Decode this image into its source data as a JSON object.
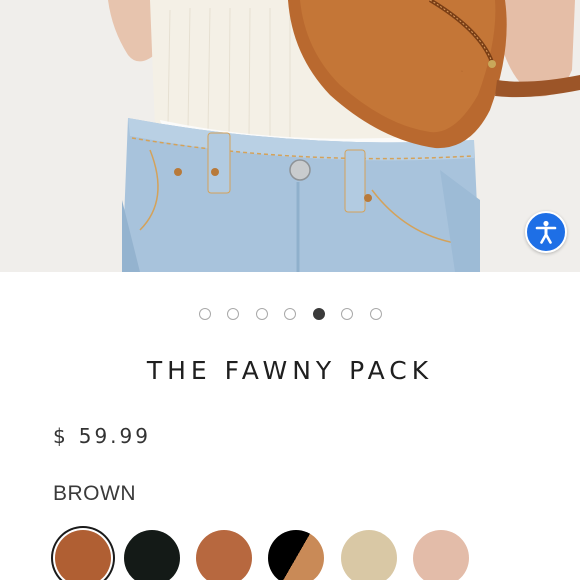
{
  "product": {
    "title": "THE FAWNY PACK",
    "price_currency": "$",
    "price_value": "59.99",
    "selected_color": "BROWN"
  },
  "carousel": {
    "count": 7,
    "active_index": 4
  },
  "swatches": [
    {
      "name": "brown",
      "color": "#b05f33",
      "selected": true
    },
    {
      "name": "black",
      "color": "#141a17",
      "selected": false
    },
    {
      "name": "rust",
      "color": "#b7683f",
      "selected": false
    },
    {
      "name": "black-tan",
      "color": "#000000",
      "color2": "#c98a57",
      "selected": false
    },
    {
      "name": "sand",
      "color": "#d9c8a5",
      "selected": false
    },
    {
      "name": "blush",
      "color": "#e3bca9",
      "selected": false
    }
  ],
  "icons": {
    "accessibility": "accessibility-icon"
  },
  "colors": {
    "accessibility_button": "#1e6fe6",
    "active_dot": "#3b3b3b"
  }
}
